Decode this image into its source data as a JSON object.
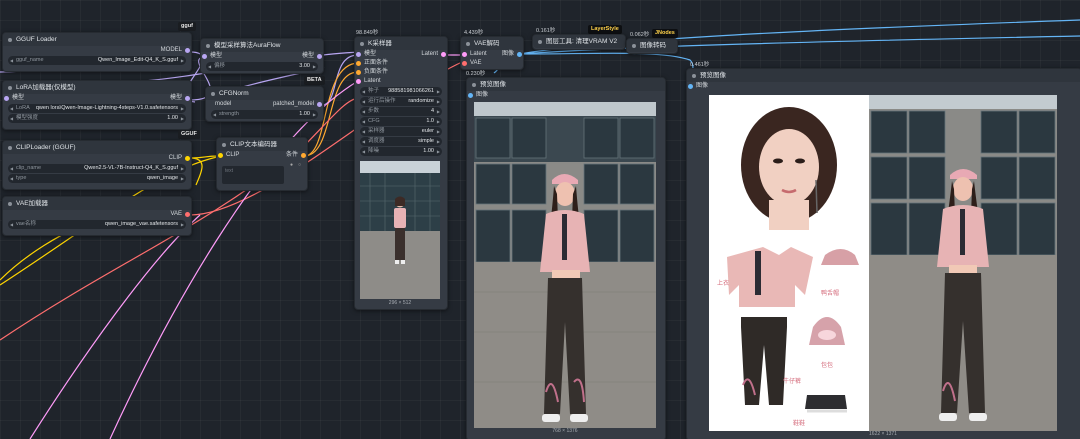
{
  "nodes": {
    "gguf_loader": {
      "title": "GGUF Loader",
      "output": "MODEL",
      "param_key": "gguf_name",
      "param_value": "Qwen_Image_Edit-Q4_K_S.gguf",
      "tag": "gguf"
    },
    "lora": {
      "title": "LoRA加载器(仅模型)",
      "input": "模型",
      "output": "模型",
      "param1_key": "LoRA",
      "param1_value": "qwen lora\\Qwen-Image-Lightning-4steps-V1.0.safetensors",
      "param2_key": "模型强度",
      "param2_value": "1.00"
    },
    "clip_loader": {
      "title": "CLIPLoader (GGUF)",
      "output": "CLIP",
      "param1_key": "clip_name",
      "param1_value": "Qwen2.5-VL-7B-Instruct-Q4_K_S.gguf",
      "param2_key": "type",
      "param2_value": "qwen_image",
      "tag": "GGUF"
    },
    "vae_loader": {
      "title": "VAE加载器",
      "output": "VAE",
      "param_key": "vae名称",
      "param_value": "qwen_image_vae.safetensors"
    },
    "auraflow": {
      "title": "模型采样算法AuraFlow",
      "input": "模型",
      "output": "模型",
      "param_key": "偏移",
      "param_value": "3.00"
    },
    "cfgnorm": {
      "title": "CFGNorm",
      "input": "model",
      "output": "patched_model",
      "param_key": "strength",
      "param_value": "1.00",
      "tag": "BETA"
    },
    "clip_encode": {
      "title": "CLIP文本编码器",
      "input": "CLIP",
      "output": "条件",
      "placeholder": "text"
    },
    "ksampler": {
      "title": "K采样器",
      "timing": "98.849秒",
      "inputs": [
        "模型",
        "正面条件",
        "负面条件",
        "Latent"
      ],
      "output": "Latent",
      "params": [
        {
          "k": "种子",
          "v": "988581981066261"
        },
        {
          "k": "运行后操作",
          "v": "randomize"
        },
        {
          "k": "步数",
          "v": "4"
        },
        {
          "k": "CFG",
          "v": "1.0"
        },
        {
          "k": "采样器",
          "v": "euler"
        },
        {
          "k": "调度器",
          "v": "simple"
        },
        {
          "k": "降噪",
          "v": "1.00"
        }
      ],
      "preview_caption": "296 × 512"
    },
    "vae_decode": {
      "title": "VAE解码",
      "timing": "4.439秒",
      "inputs": [
        "Latent",
        "VAE"
      ],
      "output": "图像",
      "timing2": "0.230秒"
    },
    "vram": {
      "title": "清理VRAM V2",
      "prefix": "图层工具:",
      "timing": "0.161秒",
      "tag": "LayerStyle"
    },
    "image_compare": {
      "title": "图像转码",
      "timing": "0.062秒",
      "tag": "JNodes"
    },
    "preview1": {
      "title": "预览图像",
      "input": "图像",
      "caption": "768 × 1376"
    },
    "preview2": {
      "title": "预览图像",
      "input": "图像",
      "timing": "0.461秒",
      "caption": "1622 × 1371"
    }
  },
  "reference_labels": {
    "top": "上衣",
    "cap": "鸭舌帽",
    "bag": "包包",
    "pants": "牛仔裤",
    "shoes": "鞋鞋"
  },
  "colors": {
    "canvas": "#1f242b",
    "node": "#353b44",
    "model_wire": "#b8a6f2",
    "clip_wire": "#ffd500",
    "vae_wire": "#ff6e6e",
    "latent_wire": "#ff9cf9",
    "image_wire": "#64b5f6",
    "cond_wire": "#ffa931"
  }
}
